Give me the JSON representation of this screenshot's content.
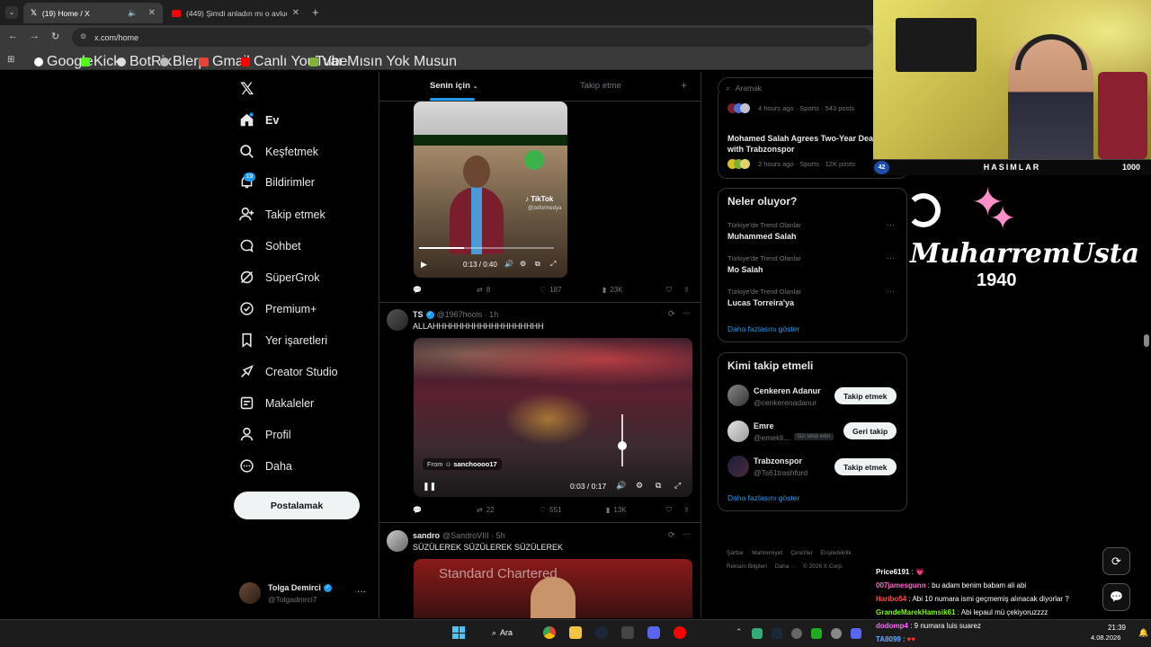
{
  "browser": {
    "tabs": [
      {
        "title": "(19) Home / X"
      },
      {
        "title": "(449) Şimdi anladın mı o avlud..."
      }
    ],
    "url": "x.com/home",
    "bookmarks": [
      "Google",
      "Kick",
      "BotRix",
      "Blerp",
      "Gmail",
      "Canlı YouTube",
      "Var Mısın Yok Musun"
    ]
  },
  "nav": {
    "items": [
      "Ev",
      "Keşfetmek",
      "Bildirimler",
      "Takip etmek",
      "Sohbet",
      "SüperGrok",
      "Premium+",
      "Yer işaretleri",
      "Creator Studio",
      "Makaleler",
      "Profil",
      "Daha"
    ],
    "notif_badge": "19",
    "post_label": "Postalamak",
    "user_name": "Tolga Demirci",
    "user_handle": "@Tolgadmrci7"
  },
  "feed": {
    "tab_for_you": "Senin için",
    "tab_following": "Takip etme",
    "post1": {
      "video_time": "0:13 / 0:40",
      "tiktok_label": "TikTok",
      "tiktok_handle": "@zeformedya",
      "stats": {
        "replies": "",
        "reposts": "8",
        "likes": "187",
        "views": "23K"
      }
    },
    "post2": {
      "name": "TS",
      "handle": "@1967hools · 1h",
      "text": "ALLAHHHHHHHHHHHHHHHHHHH",
      "from_label": "From",
      "from_user": "sanchoooo17",
      "video_time": "0:03 / 0:17",
      "stats": {
        "replies": "",
        "reposts": "22",
        "likes": "551",
        "views": "13K"
      }
    },
    "post3": {
      "name": "sandro",
      "handle": "@SandroVIII · 5h",
      "text": "SÜZÜLEREK SÜZÜLEREK SÜZÜLEREK",
      "image_caption": "Standard Chartered"
    }
  },
  "right": {
    "search_placeholder": "Aramak",
    "news": [
      {
        "meta": "4 hours ago · Sports · 543 posts"
      },
      {
        "title": "Mohamed Salah Agrees Two-Year Deal with Trabzonspor",
        "meta": "2 hours ago · Sports · 12K posts"
      }
    ],
    "trends_title": "Neler oluyor?",
    "trends": [
      {
        "meta": "Türkiye'de Trend Olanlar",
        "name": "Muhammed Salah"
      },
      {
        "meta": "Türkiye'de Trend Olanlar",
        "name": "Mo Salah"
      },
      {
        "meta": "Türkiye'de Trend Olanlar",
        "name": "Lucas Torreira'ya"
      }
    ],
    "show_more": "Daha fazlasını göster",
    "follow_title": "Kimi takip etmeli",
    "follow": [
      {
        "name": "Cenkeren Adanur",
        "handle": "@cenkerenadanur",
        "btn": "Takip etmek"
      },
      {
        "name": "Emre",
        "handle": "@emekli...",
        "tag": "Sizi takip eder",
        "btn": "Geri takip"
      },
      {
        "name": "Trabzonspor",
        "handle": "@Ts61trashford",
        "btn": "Takip etmek"
      }
    ],
    "footer": [
      "Şartlar",
      "Mahremiyet",
      "Çerezler",
      "Erişilebilirlik",
      "Reklam Bilgileri",
      "Daha ···",
      "© 2026 X Corp."
    ]
  },
  "stream": {
    "bar_left": "42",
    "bar_title": "HASIMLAR",
    "bar_right": "1000",
    "logo_name": "MuharremUsta",
    "logo_year": "1940",
    "chat": [
      {
        "user": "Price6191",
        "msg": "",
        "color": "#ffffff"
      },
      {
        "user": "007jamesgunn",
        "msg": "bu adam benim babam ali abi",
        "color": "#ff66cc"
      },
      {
        "user": "Haribo54",
        "msg": "Abi 10 numara ismi geçmemiş alınacak diyorlar ?",
        "color": "#ff4d4d"
      },
      {
        "user": "GrandeMarekHamsik61",
        "msg": "Abi lepaul mü çekiyoruzzzz",
        "color": "#7CFC00"
      },
      {
        "user": "dodomp4",
        "msg": "9 numara luis suarez",
        "color": "#ff66ff"
      },
      {
        "user": "TA8099",
        "msg": "",
        "color": "#66aaff"
      }
    ]
  },
  "taskbar": {
    "search_label": "Ara",
    "time": "21:39",
    "date": "4.08.2026"
  }
}
